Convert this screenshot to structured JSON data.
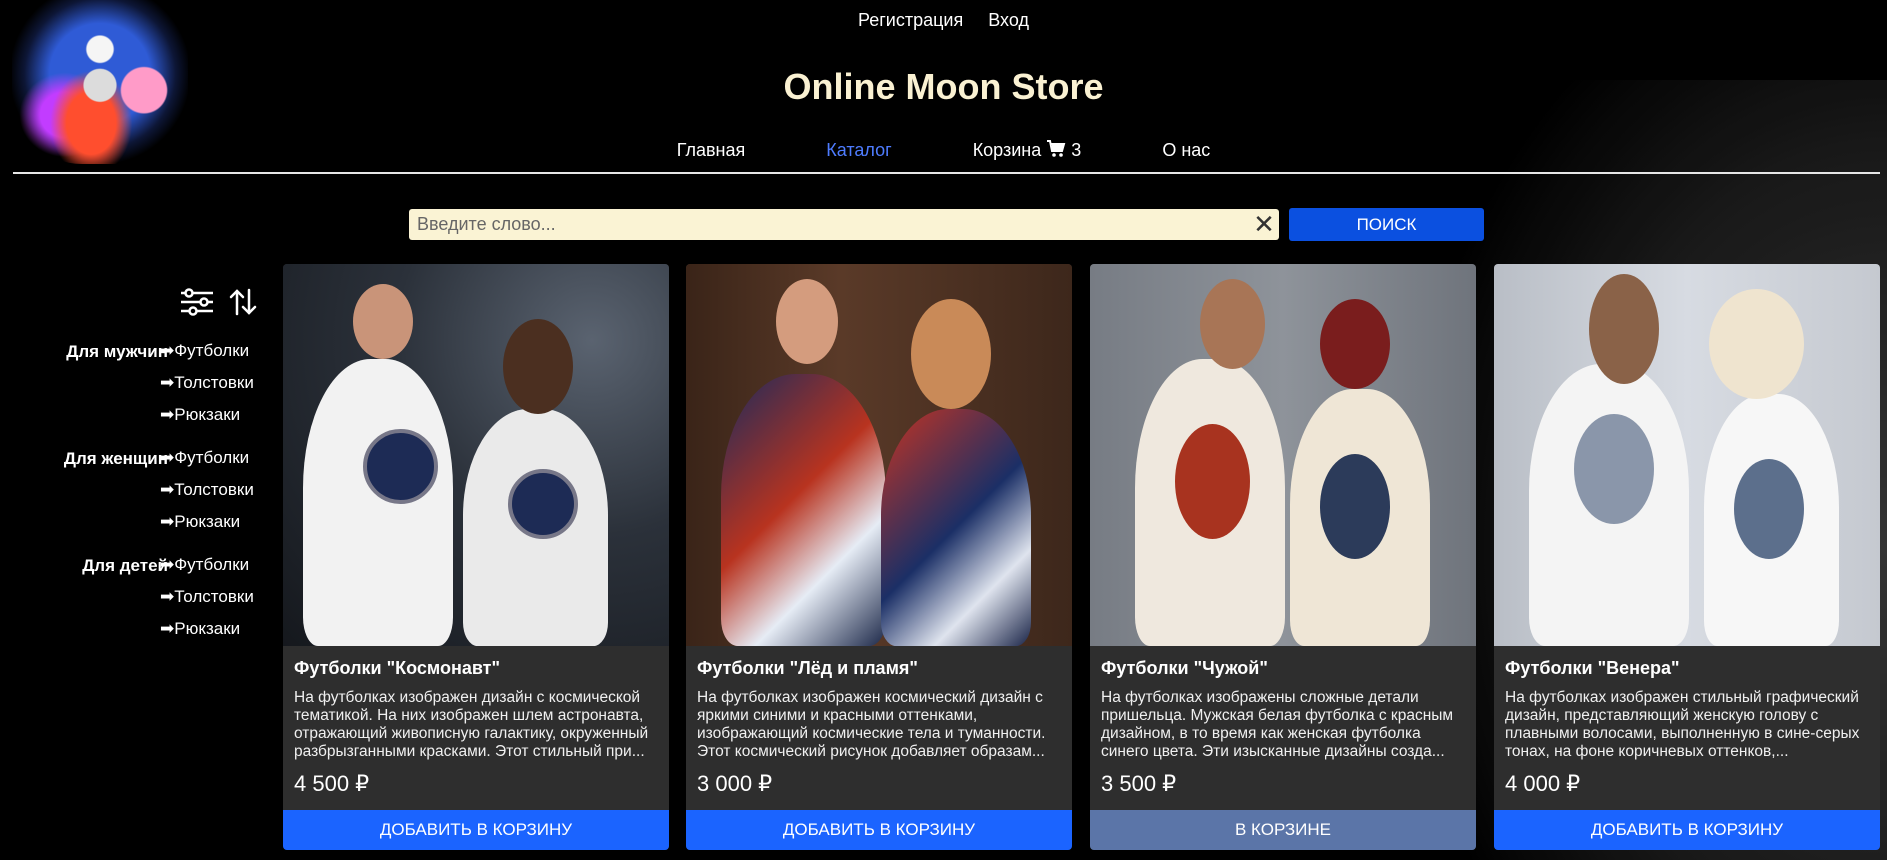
{
  "topnav": {
    "register": "Регистрация",
    "login": "Вход"
  },
  "store_title": "Online Moon Store",
  "mainnav": [
    {
      "label": "Главная",
      "active": false
    },
    {
      "label": "Каталог",
      "active": true
    },
    {
      "label": "Корзина",
      "active": false
    },
    {
      "label": "О нас",
      "active": false
    }
  ],
  "cart_count": "3",
  "search": {
    "placeholder": "Введите слово...",
    "button": "ПОИСК"
  },
  "categories": [
    {
      "group": "Для мужчин",
      "items": [
        "➡Футболки",
        "➡Толстовки",
        "➡Рюкзаки"
      ]
    },
    {
      "group": "Для женщин",
      "items": [
        "➡Футболки",
        "➡Толстовки",
        "➡Рюкзаки"
      ]
    },
    {
      "group": "Для детей",
      "items": [
        "➡Футболки",
        "➡Толстовки",
        "➡Рюкзаки"
      ]
    }
  ],
  "products": [
    {
      "name": "Футболки \"Космонавт\"",
      "description": "На футболках изображен дизайн с космической тематикой. На них изображен шлем астронавта, отражающий живописную галактику, окруженный разбрызганными красками. Этот стильный при...",
      "price": "4 500 ₽",
      "button": "ДОБАВИТЬ В КОРЗИНУ",
      "in_cart": false
    },
    {
      "name": "Футболки \"Лёд и пламя\"",
      "description": "На футболках изображен космический дизайн с яркими синими и красными оттенками, изображающий космические тела и туманности. Этот космический рисунок добавляет образам...",
      "price": "3 000 ₽",
      "button": "ДОБАВИТЬ В КОРЗИНУ",
      "in_cart": false
    },
    {
      "name": "Футболки \"Чужой\"",
      "description": "На футболках изображены сложные детали пришельца. Мужская белая футболка с красным дизайном, в то время как женская футболка синего цвета. Эти изысканные дизайны созда...",
      "price": "3 500 ₽",
      "button": "В КОРЗИНЕ",
      "in_cart": true
    },
    {
      "name": "Футболки \"Венера\"",
      "description": "На футболках изображен стильный графический дизайн, представляющий женскую голову с плавными волосами, выполненную в сине-серых тонах, на фоне коричневых оттенков,...",
      "price": "4 000 ₽",
      "button": "ДОБАВИТЬ В КОРЗИНУ",
      "in_cart": false
    }
  ],
  "icons": {
    "filter": "sliders-icon",
    "sort": "sort-arrows-icon",
    "cart": "cart-icon",
    "clear": "close-icon"
  },
  "colors": {
    "accent": "#1b64ff",
    "active_nav": "#4e7cff",
    "title": "#faf1d2",
    "in_cart": "#5b75a8"
  }
}
